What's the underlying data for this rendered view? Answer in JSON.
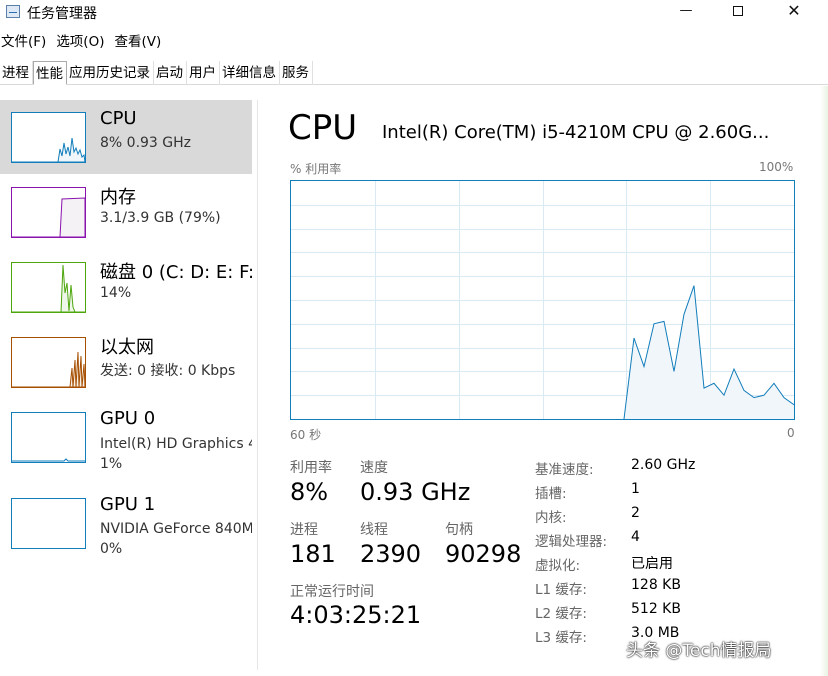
{
  "window": {
    "title": "任务管理器",
    "minimize_glyph": "—",
    "close_glyph": "✕"
  },
  "menu": [
    "文件(F)",
    "选项(O)",
    "查看(V)"
  ],
  "tabs": [
    {
      "label": "进程",
      "active": false
    },
    {
      "label": "性能",
      "active": true
    },
    {
      "label": "应用历史记录",
      "active": false
    },
    {
      "label": "启动",
      "active": false
    },
    {
      "label": "用户",
      "active": false
    },
    {
      "label": "详细信息",
      "active": false
    },
    {
      "label": "服务",
      "active": false
    }
  ],
  "resources": [
    {
      "name": "CPU",
      "line1": "8% 0.93 GHz",
      "line2": "",
      "color": "#117dbb",
      "selected": true
    },
    {
      "name": "内存",
      "line1": "3.1/3.9 GB (79%)",
      "line2": "",
      "color": "#8b12ae",
      "selected": false
    },
    {
      "name": "磁盘 0 (C: D: E: F:",
      "line1": "14%",
      "line2": "",
      "color": "#4da60c",
      "selected": false
    },
    {
      "name": "以太网",
      "line1": "发送: 0 接收: 0 Kbps",
      "line2": "",
      "color": "#a74f01",
      "selected": false
    },
    {
      "name": "GPU 0",
      "line1": "Intel(R) HD Graphics 4",
      "line2": "1%",
      "color": "#117dbb",
      "selected": false
    },
    {
      "name": "GPU 1",
      "line1": "NVIDIA GeForce 840M",
      "line2": "0%",
      "color": "#117dbb",
      "selected": false
    }
  ],
  "detail": {
    "title": "CPU",
    "model": "Intel(R) Core(TM) i5-4210M CPU @ 2.60G...",
    "y_label": "% 利用率",
    "y_max_label": "100%",
    "x_left_label": "60 秒",
    "x_right_label": "0",
    "graph_color": "#117dbb",
    "graph_fill": "#f1f6fa",
    "utilization_history_percent": [
      0,
      0,
      0,
      0,
      0,
      0,
      0,
      0,
      0,
      0,
      0,
      0,
      0,
      0,
      0,
      0,
      0,
      0,
      0,
      0,
      0,
      0,
      0,
      0,
      0,
      0,
      0,
      0,
      0,
      0,
      0,
      0,
      0,
      0,
      0,
      0,
      0,
      0,
      0,
      0,
      0,
      0,
      0,
      0,
      0,
      0,
      0,
      0,
      0,
      0,
      0,
      0,
      0,
      0,
      0,
      0,
      0,
      0,
      0,
      0,
      0,
      0,
      0,
      0,
      0,
      0,
      0,
      0,
      0,
      0,
      0,
      0,
      0,
      0,
      0,
      0,
      0,
      0,
      0,
      0,
      0,
      0,
      0,
      0,
      0,
      0,
      0,
      0,
      0,
      0,
      0,
      0,
      0,
      0,
      0,
      0,
      0,
      0,
      0,
      0,
      0,
      0,
      0,
      0,
      0,
      0,
      0,
      0,
      0,
      0,
      0,
      0,
      0,
      0,
      0,
      0,
      0,
      0,
      0,
      0,
      0,
      0,
      0,
      0,
      0,
      0,
      0,
      0,
      0,
      0,
      0,
      0,
      0,
      0,
      0,
      0,
      0,
      0,
      0,
      0,
      0,
      0,
      0,
      0,
      0,
      0,
      0,
      0,
      0,
      0,
      0,
      0,
      0,
      0,
      0,
      0,
      0,
      0,
      0,
      0,
      0,
      0,
      0,
      0,
      0,
      0,
      0,
      0,
      0,
      0,
      0,
      0,
      0,
      0,
      0,
      0,
      0,
      0,
      0,
      0,
      0,
      0,
      0,
      0,
      0,
      0,
      0,
      0,
      0,
      0,
      0,
      0,
      0,
      0,
      0,
      0,
      0,
      0,
      0,
      0,
      0,
      0,
      0,
      0,
      0,
      0,
      0,
      0,
      0,
      0,
      0,
      0,
      0,
      0,
      0,
      0,
      0,
      0,
      0,
      0,
      0,
      0,
      0,
      0,
      0,
      0,
      0,
      0,
      0,
      0,
      0,
      0,
      0,
      0,
      0,
      0,
      0,
      0,
      0,
      0,
      0,
      0,
      0,
      0,
      0,
      0,
      0,
      0,
      0,
      0,
      0,
      0,
      0,
      0,
      0,
      0,
      0,
      0,
      0,
      0,
      0,
      0,
      0,
      0,
      0,
      0,
      0,
      0,
      0,
      0,
      0,
      0,
      0,
      0,
      0,
      0,
      0,
      0,
      0,
      0,
      0,
      0,
      0,
      0,
      0,
      0,
      0,
      0,
      0,
      0,
      0,
      0,
      0,
      0,
      0,
      0,
      0,
      0,
      0,
      0,
      0,
      0,
      0,
      0,
      0,
      0,
      0,
      0,
      0,
      0,
      0,
      0,
      0,
      0,
      0,
      0,
      0,
      0,
      0,
      0,
      0,
      0,
      0,
      0,
      0,
      0,
      0,
      0,
      0,
      0,
      0,
      0,
      0,
      0,
      0,
      0,
      0,
      0,
      0,
      0,
      0,
      0,
      0,
      0,
      0,
      0,
      0,
      0,
      0,
      0,
      0,
      0,
      0,
      0,
      0,
      0,
      0,
      0,
      0,
      0
    ],
    "utilization_recent_percent": [
      0,
      34,
      22,
      40,
      41,
      20,
      44,
      56,
      13,
      15,
      10,
      21,
      12,
      9,
      10,
      15,
      9,
      6
    ],
    "stats": [
      {
        "label": "利用率",
        "value": "8%"
      },
      {
        "label": "速度",
        "value": "0.93 GHz"
      },
      {
        "label": "进程",
        "value": "181"
      },
      {
        "label": "线程",
        "value": "2390"
      },
      {
        "label": "句柄",
        "value": "90298"
      },
      {
        "label": "正常运行时间",
        "value": "4:03:25:21"
      }
    ],
    "specs": [
      {
        "label": "基准速度:",
        "value": "2.60 GHz"
      },
      {
        "label": "插槽:",
        "value": "1"
      },
      {
        "label": "内核:",
        "value": "2"
      },
      {
        "label": "逻辑处理器:",
        "value": "4"
      },
      {
        "label": "虚拟化:",
        "value": "已启用"
      },
      {
        "label": "L1 缓存:",
        "value": "128 KB"
      },
      {
        "label": "L2 缓存:",
        "value": "512 KB"
      },
      {
        "label": "L3 缓存:",
        "value": "3.0 MB"
      }
    ]
  },
  "watermark": "头条 @Tech情报局"
}
